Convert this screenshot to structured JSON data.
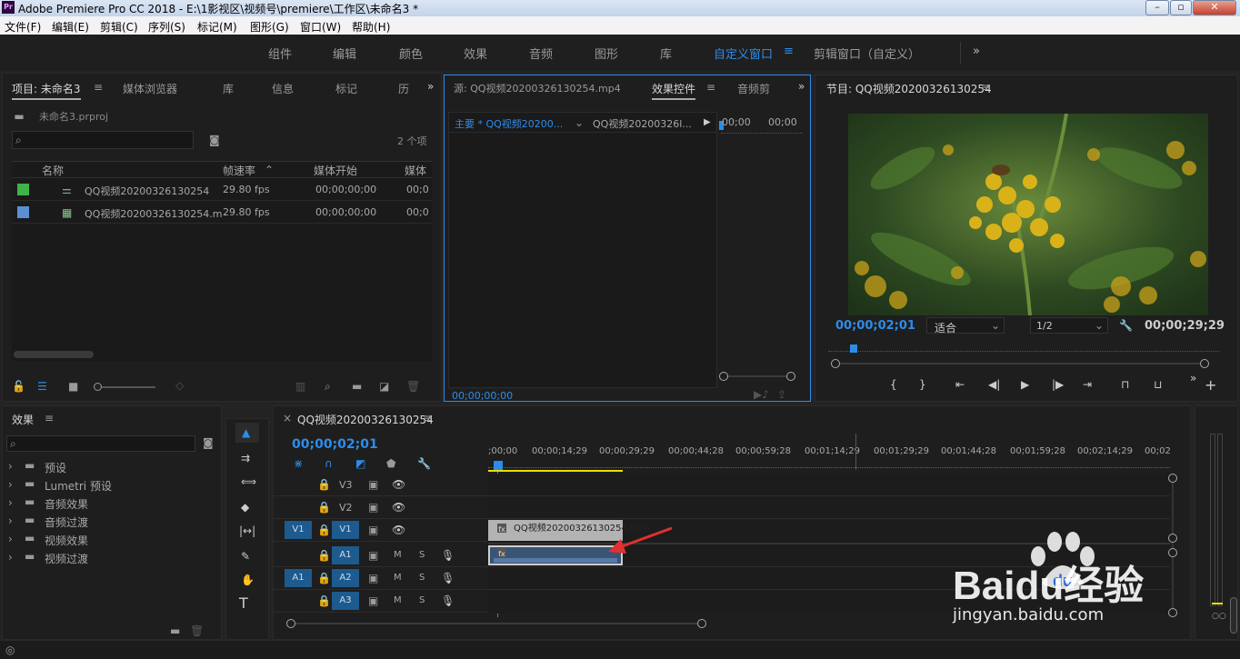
{
  "window": {
    "title": "Adobe Premiere Pro CC 2018 - E:\\1影视区\\视频号\\premiere\\工作区\\未命名3 *",
    "logo": "Pr"
  },
  "menu": [
    "文件(F)",
    "编辑(E)",
    "剪辑(C)",
    "序列(S)",
    "标记(M)",
    "图形(G)",
    "窗口(W)",
    "帮助(H)"
  ],
  "workspaces": [
    "组件",
    "编辑",
    "颜色",
    "效果",
    "音频",
    "图形",
    "库",
    "自定义窗口",
    "剪辑窗口（自定义）"
  ],
  "project": {
    "tabs": [
      "项目: 未命名3",
      "媒体浏览器",
      "库",
      "信息",
      "标记",
      "历"
    ],
    "file": "未命名3.prproj",
    "count": "2 个项",
    "columns": [
      "名称",
      "帧速率",
      "媒体开始",
      "媒体"
    ],
    "rows": [
      {
        "name": "QQ视频20200326130254",
        "fps": "29.80 fps",
        "start": "00;00;00;00",
        "media": "00;0",
        "color": "#3fb24b"
      },
      {
        "name": "QQ视频20200326130254.m",
        "fps": "29.80 fps",
        "start": "00;00;00;00",
        "media": "00;0",
        "color": "#5b8fd4"
      }
    ]
  },
  "source": {
    "tabs": [
      "源: QQ视频20200326130254.mp4",
      "效果控件",
      "音频剪"
    ],
    "master": "主要 * QQ视频20200...",
    "clip": "QQ视频20200326l...",
    "times": [
      "00;00",
      "00;00"
    ],
    "timecode": "00;00;00;00"
  },
  "program": {
    "tab": "节目: QQ视频20200326130254",
    "timecode": "00;00;02;01",
    "fit": "适合",
    "res": "1/2",
    "duration": "00;00;29;29"
  },
  "effects": {
    "tab": "效果",
    "items": [
      "预设",
      "Lumetri 预设",
      "音频效果",
      "音频过渡",
      "视频效果",
      "视频过渡"
    ]
  },
  "timeline": {
    "tab": "QQ视频20200326130254",
    "timecode": "00;00;02;01",
    "ruler": [
      ";00;00",
      "00;00;14;29",
      "00;00;29;29",
      "00;00;44;28",
      "00;00;59;28",
      "00;01;14;29",
      "00;01;29;29",
      "00;01;44;28",
      "00;01;59;28",
      "00;02;14;29",
      "00;02"
    ],
    "tracks": [
      {
        "label": "V3",
        "type": "video"
      },
      {
        "label": "V2",
        "type": "video"
      },
      {
        "label": "V1",
        "type": "video",
        "src": "V1"
      },
      {
        "label": "A1",
        "type": "audio"
      },
      {
        "label": "A2",
        "type": "audio",
        "src": "A1"
      },
      {
        "label": "A3",
        "type": "audio"
      }
    ],
    "clip_video": "QQ视频20200326130254.mp4",
    "m": "M",
    "s": "S"
  },
  "watermark": {
    "brand": "Baidu经验",
    "url": "jingyan.baidu.com"
  },
  "colors": {
    "accent": "#2d8ceb",
    "panel": "#1e1e1e",
    "bg": "#232323",
    "clip_audio": "#3a5476",
    "clip_video": "#b3b3b3"
  }
}
